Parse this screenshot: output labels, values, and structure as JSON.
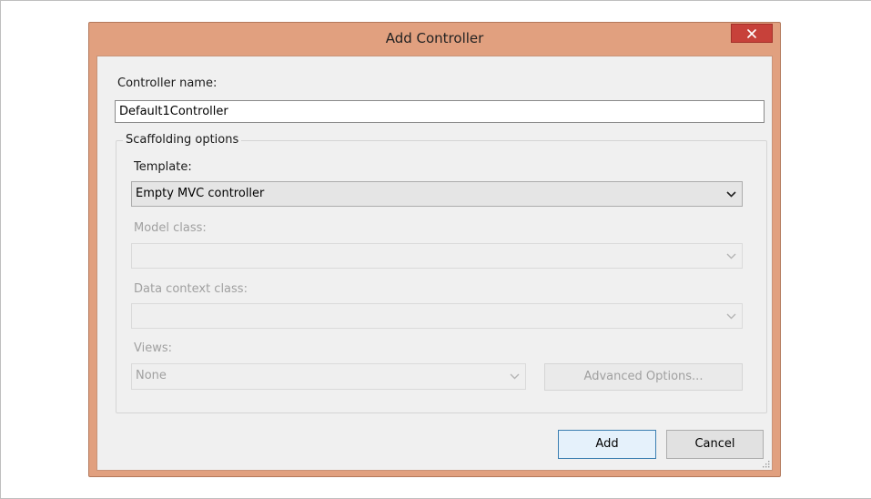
{
  "dialog": {
    "title": "Add Controller",
    "controller_name_label": "Controller name:",
    "controller_name_value": "Default1Controller",
    "scaffolding_legend": "Scaffolding options",
    "template_label": "Template:",
    "template_value": "Empty MVC controller",
    "model_class_label": "Model class:",
    "model_class_value": "",
    "data_context_label": "Data context class:",
    "data_context_value": "",
    "views_label": "Views:",
    "views_value": "None",
    "advanced_options_label": "Advanced Options...",
    "add_label": "Add",
    "cancel_label": "Cancel"
  },
  "icons": {
    "close": "close-icon",
    "dropdown": "chevron-down-icon",
    "resize": "resize-grip-icon"
  },
  "colors": {
    "titlebar": "#e1a07f",
    "close_button": "#c7413a",
    "client_background": "#f0f0f0",
    "default_button_border": "#3c7fb1"
  }
}
